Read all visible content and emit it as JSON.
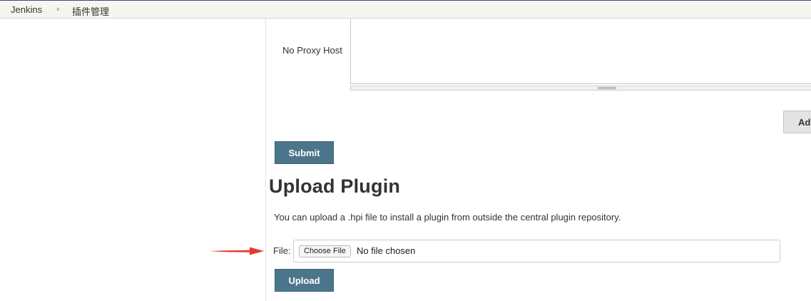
{
  "breadcrumb": {
    "home": "Jenkins",
    "page": "插件管理"
  },
  "proxy": {
    "no_proxy_host_label": "No Proxy Host",
    "no_proxy_host_value": ""
  },
  "buttons": {
    "advanced_label": "Advanced...",
    "submit_label": "Submit",
    "upload_label": "Upload"
  },
  "upload_plugin": {
    "title": "Upload Plugin",
    "description": "You can upload a .hpi file to install a plugin from outside the central plugin repository.",
    "file_label": "File:",
    "choose_file_label": "Choose File",
    "file_status": "No file chosen"
  },
  "colors": {
    "primary_button": "#4b758b",
    "annotation_arrow": "#e53b2c",
    "breadcrumb_bar": "#f6f6ef"
  }
}
